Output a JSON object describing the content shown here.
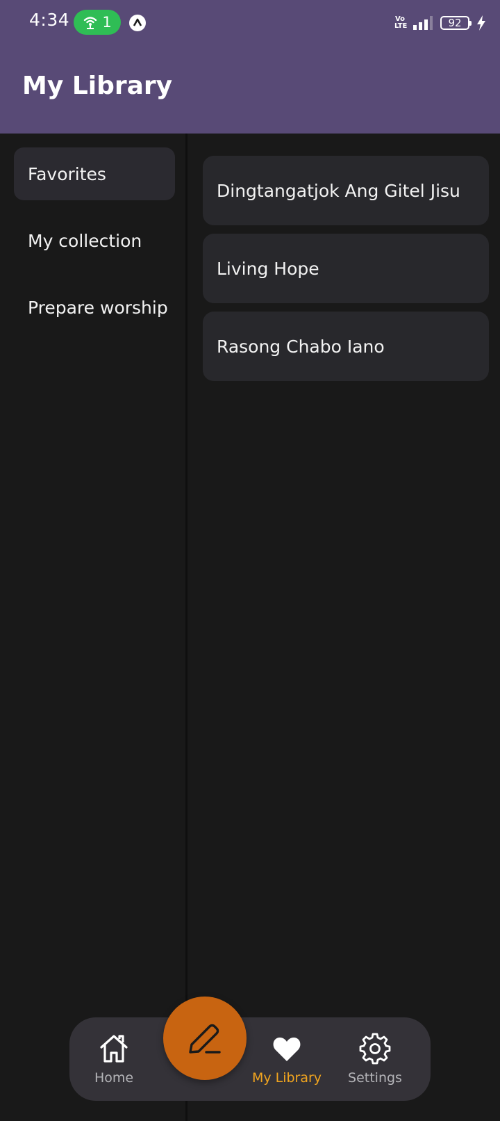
{
  "status_bar": {
    "time": "4:34",
    "hotspot_count": "1",
    "volte": "Vo LTE",
    "battery_level": "92"
  },
  "header": {
    "title": "My Library"
  },
  "sidebar": {
    "items": [
      {
        "label": "Favorites",
        "selected": true
      },
      {
        "label": "My collection",
        "selected": false
      },
      {
        "label": "Prepare worship",
        "selected": false
      }
    ]
  },
  "songs": [
    {
      "title": "Dingtangatjok Ang Gitel Jisu"
    },
    {
      "title": "Living Hope"
    },
    {
      "title": "Rasong Chabo Iano"
    }
  ],
  "bottom_nav": {
    "items": [
      {
        "label": "Home",
        "icon": "home-icon",
        "active": false
      },
      {
        "label": "My Library",
        "icon": "heart-icon",
        "active": true
      },
      {
        "label": "Settings",
        "icon": "gear-icon",
        "active": false
      }
    ],
    "fab_icon": "pencil-icon"
  },
  "colors": {
    "header": "#584a76",
    "background": "#191919",
    "card": "#28282c",
    "fab": "#c86411",
    "accent_active": "#f1a51f",
    "hotspot": "#2fbd55"
  }
}
